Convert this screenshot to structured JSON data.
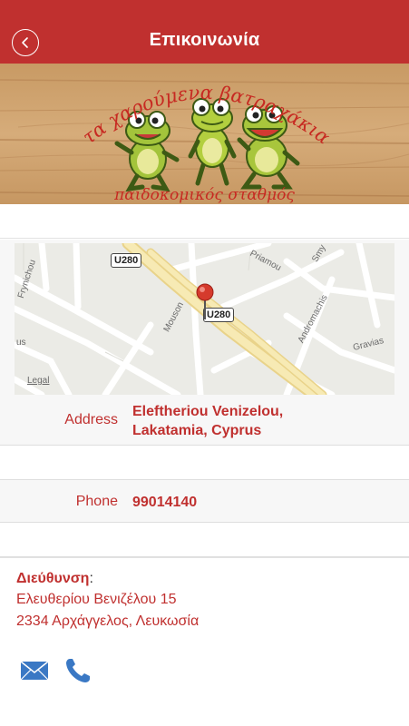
{
  "header": {
    "title": "Επικοινωνία",
    "back_icon": "chevron-left-icon",
    "color": "#c0302f"
  },
  "banner": {
    "logo_title": "τα χαρούμενα βατραχάκια",
    "logo_subtitle": "παιδοκομικός σταθμός"
  },
  "map": {
    "labels": {
      "u280_top": "U280",
      "u280_pin": "U280",
      "frynichou": "Frynichou",
      "priamou": "Priamou",
      "smy": "Smy",
      "mouson": "Mouson",
      "andromachis": "Andromachis",
      "gravias": "Gravias",
      "us": "us",
      "legal": "Legal"
    }
  },
  "address": {
    "label": "Address",
    "value_line1": "Eleftheriou Venizelou,",
    "value_line2": "Lakatamia, Cyprus"
  },
  "phone": {
    "label": "Phone",
    "value": "99014140"
  },
  "info": {
    "heading": "Διεύθυνση",
    "colon": ":",
    "line1": "Ελευθερίου Βενιζέλου 15",
    "line2": "2334 Αρχάγγελος, Λευκωσία"
  },
  "actions": {
    "email_icon": "envelope-icon",
    "phone_icon": "phone-icon",
    "icon_color": "#3a78c4"
  }
}
